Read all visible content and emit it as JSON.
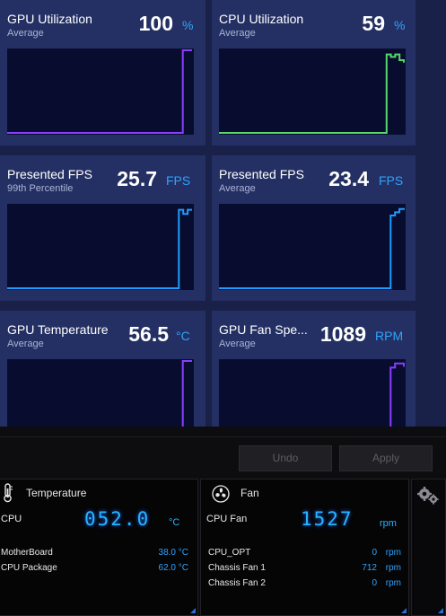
{
  "colors": {
    "accent": "#2ea3ff",
    "gpu_line": "#8a3dff",
    "cpu_line": "#52d96a",
    "fps_line": "#1e9bff",
    "card_bg": "#243063",
    "plot_bg": "#080d30"
  },
  "metrics": [
    {
      "title": "GPU Utilization",
      "sub": "Average",
      "value": "100",
      "unit": "%",
      "line_color": "#8a3dff",
      "series": [
        0,
        0,
        0,
        0,
        0,
        0,
        0,
        0,
        0,
        0,
        0,
        0,
        0,
        0,
        0,
        0,
        0,
        0,
        0,
        0,
        0,
        0,
        0,
        0,
        0,
        0,
        0,
        0,
        0,
        0,
        0,
        0,
        0,
        0,
        0,
        0,
        0,
        0,
        100,
        100,
        100
      ]
    },
    {
      "title": "CPU Utilization",
      "sub": "Average",
      "value": "59",
      "unit": "%",
      "line_color": "#52d96a",
      "series": [
        0,
        0,
        0,
        0,
        0,
        0,
        0,
        0,
        0,
        0,
        0,
        0,
        0,
        0,
        0,
        0,
        0,
        0,
        0,
        0,
        0,
        0,
        0,
        0,
        0,
        0,
        0,
        0,
        0,
        0,
        0,
        0,
        0,
        0,
        0,
        0,
        0,
        0,
        0,
        95,
        92,
        95,
        88,
        85
      ]
    },
    {
      "title": "Presented FPS",
      "sub": "99th Percentile",
      "value": "25.7",
      "unit": "FPS",
      "line_color": "#1e9bff",
      "series": [
        0,
        0,
        0,
        0,
        0,
        0,
        0,
        0,
        0,
        0,
        0,
        0,
        0,
        0,
        0,
        0,
        0,
        0,
        0,
        0,
        0,
        0,
        0,
        0,
        0,
        0,
        0,
        0,
        0,
        0,
        0,
        0,
        0,
        0,
        0,
        0,
        0,
        0,
        0,
        95,
        90,
        95,
        95
      ]
    },
    {
      "title": "Presented FPS",
      "sub": "Average",
      "value": "23.4",
      "unit": "FPS",
      "line_color": "#1e9bff",
      "series": [
        0,
        0,
        0,
        0,
        0,
        0,
        0,
        0,
        0,
        0,
        0,
        0,
        0,
        0,
        0,
        0,
        0,
        0,
        0,
        0,
        0,
        0,
        0,
        0,
        0,
        0,
        0,
        0,
        0,
        0,
        0,
        0,
        0,
        0,
        0,
        0,
        0,
        0,
        0,
        88,
        92,
        96,
        97
      ]
    },
    {
      "title": "GPU Temperature",
      "sub": "Average",
      "value": "56.5",
      "unit": "°C",
      "line_color": "#8a3dff",
      "series": [
        0,
        0,
        0,
        0,
        0,
        0,
        0,
        0,
        0,
        0,
        0,
        0,
        0,
        0,
        0,
        0,
        0,
        0,
        0,
        0,
        0,
        0,
        0,
        0,
        0,
        0,
        0,
        0,
        0,
        0,
        0,
        0,
        0,
        0,
        0,
        0,
        0,
        0,
        100,
        100,
        100
      ]
    },
    {
      "title": "GPU Fan Spe...",
      "sub": "Average",
      "value": "1089",
      "unit": "RPM",
      "line_color": "#8a3dff",
      "series": [
        0,
        0,
        0,
        0,
        0,
        0,
        0,
        0,
        0,
        0,
        0,
        0,
        0,
        0,
        0,
        0,
        0,
        0,
        0,
        0,
        0,
        0,
        0,
        0,
        0,
        0,
        0,
        0,
        0,
        0,
        0,
        0,
        0,
        0,
        0,
        0,
        0,
        0,
        0,
        92,
        97,
        97,
        93
      ]
    }
  ],
  "actions": {
    "undo": "Undo",
    "apply": "Apply"
  },
  "temperature": {
    "title": "Temperature",
    "main_label": "CPU",
    "main_value": "052.0",
    "main_unit": "°C",
    "rows": [
      {
        "label": "MotherBoard",
        "value": "38.0 °C"
      },
      {
        "label": "CPU Package",
        "value": "62.0 °C"
      }
    ]
  },
  "fan": {
    "title": "Fan",
    "main_label": "CPU Fan",
    "main_value": "1527",
    "main_unit": "rpm",
    "rows": [
      {
        "label": "CPU_OPT",
        "value": "0",
        "unit": "rpm"
      },
      {
        "label": "Chassis Fan 1",
        "value": "712",
        "unit": "rpm"
      },
      {
        "label": "Chassis Fan 2",
        "value": "0",
        "unit": "rpm"
      }
    ]
  },
  "icons": [
    "thermometer-icon",
    "fan-icon",
    "settings-gear-icon"
  ]
}
